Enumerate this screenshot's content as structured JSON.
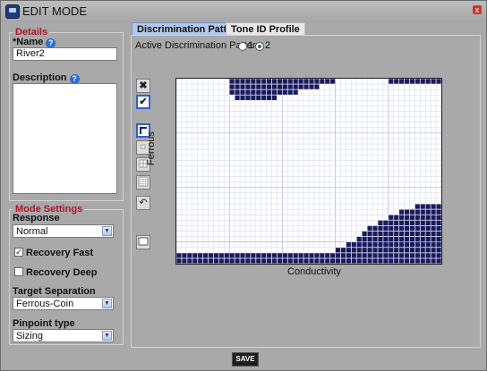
{
  "window": {
    "title": "EDIT MODE",
    "close_glyph": "x"
  },
  "details": {
    "legend": "Details",
    "name_label": "*Name",
    "name_value": "River2",
    "description_label": "Description",
    "description_value": ""
  },
  "mode_settings": {
    "legend": "Mode Settings",
    "response_label": "Response",
    "response_value": "Normal",
    "recovery_fast_label": "Recovery Fast",
    "recovery_fast_checked": true,
    "recovery_deep_label": "Recovery Deep",
    "recovery_deep_checked": false,
    "target_separation_label": "Target Separation",
    "target_separation_value": "Ferrous-Coin",
    "pinpoint_label": "Pinpoint type",
    "pinpoint_value": "Sizing"
  },
  "tabs": [
    {
      "label": "Discrimination Pattern",
      "active": true
    },
    {
      "label": "Tone ID Profile",
      "active": false
    }
  ],
  "pattern": {
    "active_label": "Active Discrimination Pattern:",
    "options": [
      "1",
      "2"
    ],
    "selected": "2",
    "x_axis_label": "Conductivity",
    "y_axis_label": "Ferrous",
    "fill_color": "#1a1a5c",
    "columns": 50,
    "rows": 34,
    "filled_cells_by_row": [
      [
        [
          10,
          29
        ],
        [
          40,
          49
        ]
      ],
      [
        [
          10,
          26
        ]
      ],
      [
        [
          10,
          22
        ]
      ],
      [
        [
          11,
          18
        ]
      ],
      [],
      [],
      [],
      [],
      [],
      [],
      [],
      [],
      [],
      [],
      [],
      [],
      [],
      [],
      [],
      [],
      [],
      [],
      [],
      [
        [
          45,
          49
        ]
      ],
      [
        [
          42,
          49
        ]
      ],
      [
        [
          40,
          49
        ]
      ],
      [
        [
          38,
          49
        ]
      ],
      [
        [
          36,
          49
        ]
      ],
      [
        [
          35,
          49
        ]
      ],
      [
        [
          34,
          49
        ]
      ],
      [
        [
          32,
          49
        ]
      ],
      [
        [
          30,
          49
        ]
      ],
      [
        [
          0,
          49
        ]
      ],
      [
        [
          0,
          49
        ]
      ]
    ]
  },
  "tools": [
    "delete-icon",
    "apply-check-icon",
    "select-cursor-icon",
    "brush-1x1-icon",
    "brush-2x2-icon",
    "brush-4x4-icon",
    "undo-icon",
    "fill-box-icon"
  ],
  "save_label": "SAVE"
}
